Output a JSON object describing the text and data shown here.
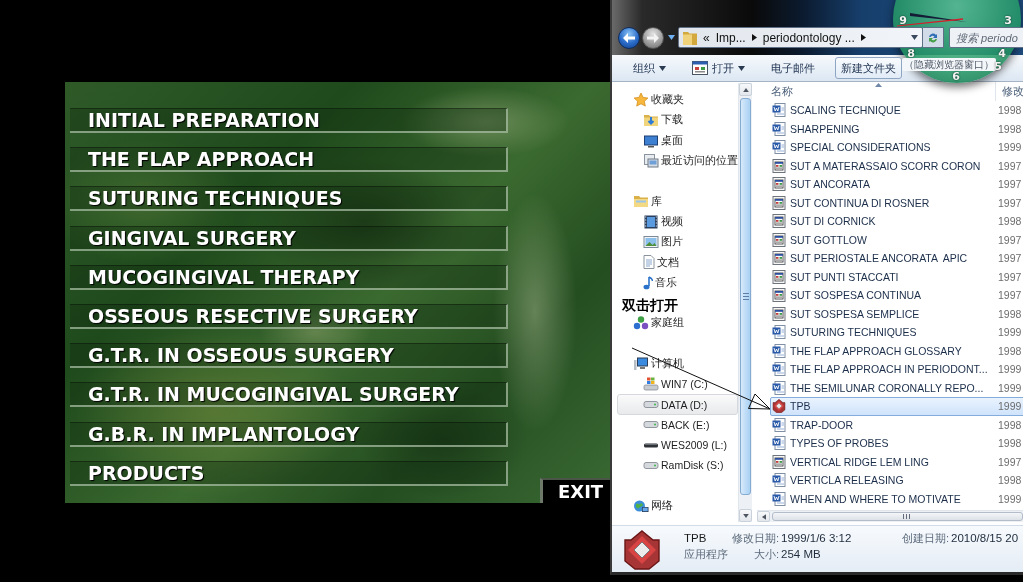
{
  "app_menu": {
    "items": [
      "INITIAL PREPARATION",
      "THE FLAP APPROACH",
      "SUTURING TECHNIQUES",
      "GINGIVAL SURGERY",
      "MUCOGINGIVAL THERAPY",
      "OSSEOUS RESECTIVE SURGERY",
      "G.T.R. IN OSSEOUS SURGERY",
      "G.T.R. IN MUCOGINGIVAL SURGERY",
      "G.B.R. IN IMPLANTOLOGY",
      "PRODUCTS"
    ],
    "exit": "EXIT"
  },
  "explorer": {
    "address": {
      "overflow": "«",
      "crumbs": [
        "Imp...",
        "periodontology ..."
      ]
    },
    "search": {
      "placeholder": "搜索 periodo"
    },
    "toolbar": [
      {
        "label": "组织",
        "icon": false,
        "dropdown": true,
        "hovered": false
      },
      {
        "label": "打开",
        "icon": true,
        "dropdown": true,
        "hovered": false
      },
      {
        "label": "电子邮件",
        "icon": false,
        "dropdown": false,
        "hovered": false
      },
      {
        "label": "新建文件夹",
        "icon": false,
        "dropdown": false,
        "hovered": true
      }
    ],
    "tooltip": "（隐藏浏览器窗口）",
    "nav": [
      {
        "label": "收藏夹",
        "kind": "favorites",
        "selected": false,
        "children": [
          {
            "label": "下载",
            "kind": "downloads",
            "selected": false
          },
          {
            "label": "桌面",
            "kind": "desktop",
            "selected": false
          },
          {
            "label": "最近访问的位置",
            "kind": "recent",
            "selected": false
          }
        ]
      },
      {
        "label": "库",
        "kind": "libraries",
        "selected": false,
        "children": [
          {
            "label": "视频",
            "kind": "videos",
            "selected": false
          },
          {
            "label": "图片",
            "kind": "pictures",
            "selected": false
          },
          {
            "label": "文档",
            "kind": "documents",
            "selected": false
          },
          {
            "label": "音乐",
            "kind": "music",
            "selected": false
          }
        ]
      },
      {
        "label": "家庭组",
        "kind": "homegroup",
        "selected": false
      },
      {
        "label": "计算机",
        "kind": "computer",
        "selected": false,
        "children": [
          {
            "label": "WIN7 (C:)",
            "kind": "system-drive",
            "selected": false
          },
          {
            "label": "DATA (D:)",
            "kind": "drive",
            "selected": true
          },
          {
            "label": "BACK (E:)",
            "kind": "drive",
            "selected": false
          },
          {
            "label": "WES2009 (L:)",
            "kind": "removable-drive",
            "selected": false
          },
          {
            "label": "RamDisk (S:)",
            "kind": "drive",
            "selected": false
          }
        ]
      },
      {
        "label": "网络",
        "kind": "network",
        "selected": false
      }
    ],
    "columns": [
      "名称",
      "修改"
    ],
    "files": [
      {
        "name": "SCALING TECHNIQUE",
        "kind": "doc",
        "date": "1998",
        "selected": false
      },
      {
        "name": "SHARPENING",
        "kind": "doc",
        "date": "1998",
        "selected": false
      },
      {
        "name": "SPECIAL CONSIDERATIONS",
        "kind": "doc",
        "date": "1999",
        "selected": false
      },
      {
        "name": "SUT A MATERASSAIO SCORR CORON",
        "kind": "form",
        "date": "1997",
        "selected": false
      },
      {
        "name": "SUT ANCORATA",
        "kind": "form",
        "date": "1997",
        "selected": false
      },
      {
        "name": "SUT CONTINUA DI ROSNER",
        "kind": "form",
        "date": "1997",
        "selected": false
      },
      {
        "name": "SUT DI CORNICK",
        "kind": "form",
        "date": "1998",
        "selected": false
      },
      {
        "name": "SUT GOTTLOW",
        "kind": "form",
        "date": "1997",
        "selected": false
      },
      {
        "name": "SUT PERIOSTALE ANCORATA  APIC",
        "kind": "form",
        "date": "1997",
        "selected": false
      },
      {
        "name": "SUT PUNTI STACCATI",
        "kind": "form",
        "date": "1997",
        "selected": false
      },
      {
        "name": "SUT SOSPESA CONTINUA",
        "kind": "form",
        "date": "1997",
        "selected": false
      },
      {
        "name": "SUT SOSPESA SEMPLICE",
        "kind": "form",
        "date": "1998",
        "selected": false
      },
      {
        "name": "SUTURING TECHNIQUES",
        "kind": "doc",
        "date": "1999",
        "selected": false
      },
      {
        "name": "THE FLAP APPROACH GLOSSARY",
        "kind": "doc",
        "date": "1998",
        "selected": false
      },
      {
        "name": "THE FLAP APPROACH IN PERIODONT...",
        "kind": "doc",
        "date": "1999",
        "selected": false
      },
      {
        "name": "THE SEMILUNAR CORONALLY REPO...",
        "kind": "doc",
        "date": "1999",
        "selected": false
      },
      {
        "name": "TPB",
        "kind": "app",
        "date": "1999",
        "selected": true
      },
      {
        "name": "TRAP-DOOR",
        "kind": "doc",
        "date": "1998",
        "selected": false
      },
      {
        "name": "TYPES OF PROBES",
        "kind": "doc",
        "date": "1998",
        "selected": false
      },
      {
        "name": "VERTICAL RIDGE LEM LING",
        "kind": "form",
        "date": "1997",
        "selected": false
      },
      {
        "name": "VERTICLA RELEASING",
        "kind": "doc",
        "date": "1998",
        "selected": false
      },
      {
        "name": "WHEN AND WHERE TO MOTIVATE",
        "kind": "doc",
        "date": "1999",
        "selected": false
      }
    ],
    "details": {
      "name": "TPB",
      "type": "应用程序",
      "modified_label": "修改日期:",
      "modified": "1999/1/6 3:12",
      "size_label": "大小:",
      "size": "254 MB",
      "created_label": "创建日期:",
      "created": "2010/8/15 20"
    }
  },
  "clock": {
    "numerals": [
      "3",
      "4",
      "5",
      "6",
      "8",
      "9"
    ]
  },
  "annotation": {
    "text": "双击打开"
  }
}
